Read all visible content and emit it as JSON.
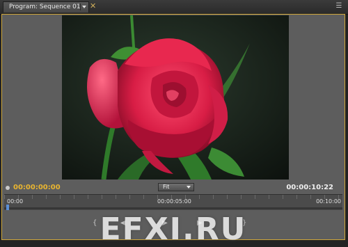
{
  "tab": {
    "title": "Program: Sequence 01",
    "close_glyph": "✕"
  },
  "panel_menu_icon": "panel-menu-icon",
  "timecode": {
    "current": "00:00:00:00",
    "duration": "00:00:10:22"
  },
  "zoom": {
    "selected": "Fit"
  },
  "ruler": {
    "start": "00:00",
    "middle": "00:00:05:00",
    "end": "00:10:00"
  },
  "watermark": "EFXI.RU",
  "colors": {
    "accent_border": "#cfa63a",
    "timecode_current": "#e9b530",
    "playhead": "#5b8fd6"
  }
}
